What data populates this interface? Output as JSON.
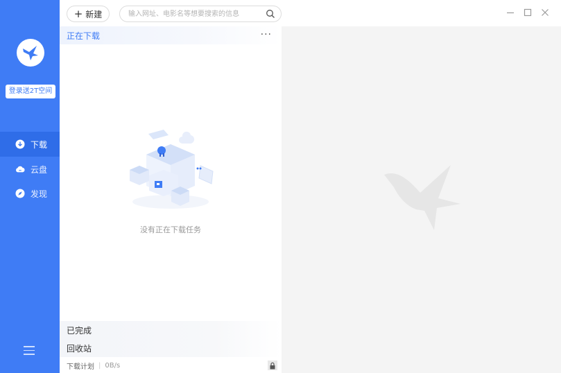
{
  "sidebar": {
    "login_label": "登录送2T空间",
    "items": [
      {
        "label": "下载",
        "icon": "download-icon",
        "active": true
      },
      {
        "label": "云盘",
        "icon": "cloud-icon",
        "active": false
      },
      {
        "label": "发现",
        "icon": "compass-icon",
        "active": false
      }
    ]
  },
  "toolbar": {
    "new_label": "新建",
    "new_icon": "plus-icon",
    "search_placeholder": "输入网址、电影名等想要搜索的信息",
    "search_value": ""
  },
  "list": {
    "downloading_label": "正在下载",
    "more_label": "···",
    "empty_text": "没有正在下载任务",
    "completed_label": "已完成",
    "recycle_label": "回收站"
  },
  "footer": {
    "plan_label": "下载计划",
    "speed": "0B/s"
  },
  "colors": {
    "accent": "#3f7cf5",
    "accent_dark": "#2f6de8",
    "detail_bg": "#f4f4f4"
  }
}
